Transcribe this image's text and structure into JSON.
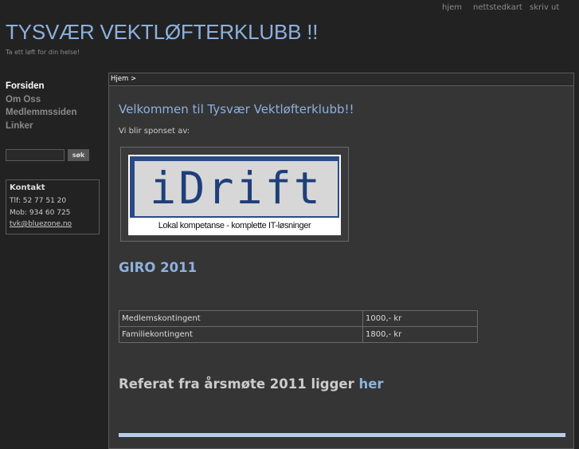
{
  "header": {
    "site_title": "TYSVÆR VEKTLØFTERKLUBB !!",
    "tagline": "Ta ett løft for din helse!",
    "top_nav": [
      "hjem",
      "nettstedkart",
      "skriv ut"
    ]
  },
  "sidebar": {
    "menu": [
      "Forsiden",
      "Om Oss",
      "Medlemmssiden",
      "Linker"
    ],
    "search_button": "søk",
    "contact": {
      "title": "Kontakt",
      "phone": "Tlf: 52 77 51 20",
      "mobile": "Mob: 934 60 725",
      "email": "tvk@bluezone.no"
    }
  },
  "main": {
    "breadcrumb": "Hjem >",
    "welcome": "Velkommen til Tysvær Vektløfterklubb!!",
    "sponsor_text": "Vi blir sponset av:",
    "sponsor_logo": {
      "word": "iDrift",
      "slogan": "Lokal kompetanse - komplette IT-løsninger"
    },
    "giro_heading": "GIRO 2011",
    "fees": [
      {
        "label": "Medlemskontingent",
        "amount": "1000,- kr"
      },
      {
        "label": "Familiekontingent",
        "amount": "1800,- kr"
      }
    ],
    "referat_text": "Referat fra årsmøte 2011 ligger ",
    "referat_link": "her"
  },
  "colors": {
    "background": "#222222",
    "content_bg": "#353535",
    "accent": "#8db1df",
    "logo_blue": "#2b4a85"
  }
}
